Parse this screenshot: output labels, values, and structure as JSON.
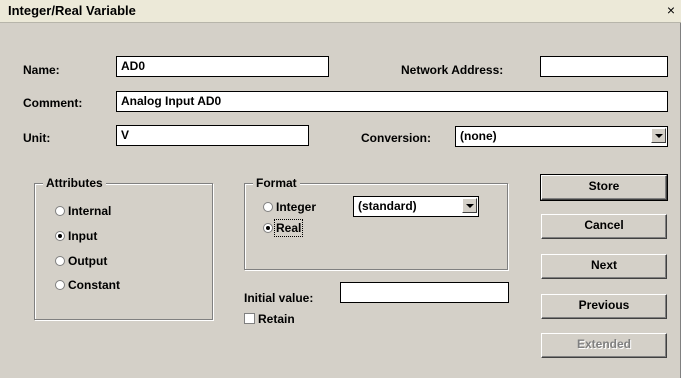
{
  "window": {
    "title": "Integer/Real Variable",
    "close_label": "×"
  },
  "fields": {
    "name_label": "Name:",
    "name_value": "AD0",
    "network_label": "Network Address:",
    "network_value": "",
    "comment_label": "Comment:",
    "comment_value": "Analog Input AD0",
    "unit_label": "Unit:",
    "unit_value": "V",
    "conversion_label": "Conversion:",
    "conversion_value": "(none)"
  },
  "attributes": {
    "legend": "Attributes",
    "options": [
      "Internal",
      "Input",
      "Output",
      "Constant"
    ],
    "selected": "Input"
  },
  "format": {
    "legend": "Format",
    "options": [
      "Integer",
      "Real"
    ],
    "selected": "Real",
    "integer_format_value": "(standard)"
  },
  "initial_value": {
    "label": "Initial value:",
    "value": ""
  },
  "retain": {
    "label": "Retain",
    "checked": false
  },
  "buttons": {
    "store": "Store",
    "cancel": "Cancel",
    "next": "Next",
    "previous": "Previous",
    "extended": "Extended"
  }
}
